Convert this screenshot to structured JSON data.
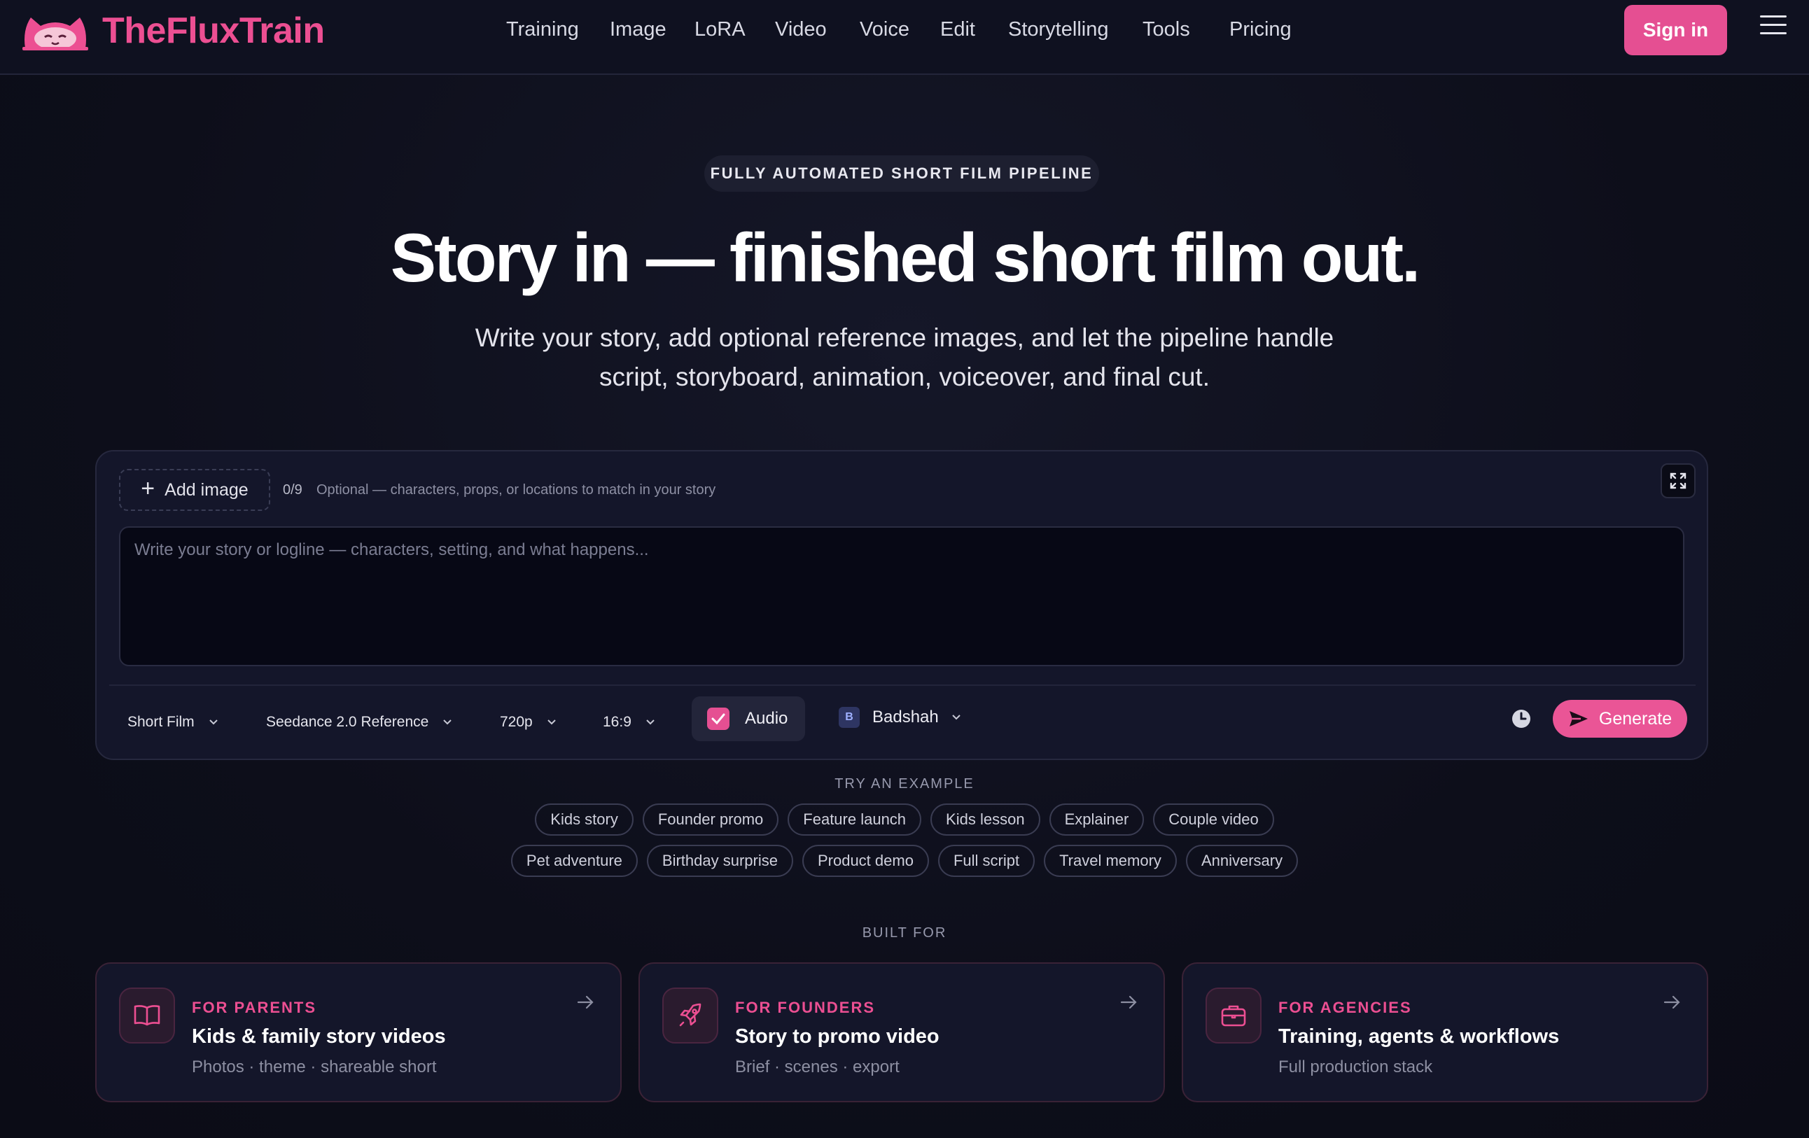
{
  "brand": {
    "name": "TheFluxTrain",
    "accent": "#ec4f92"
  },
  "nav": {
    "items": [
      "Training",
      "Image",
      "LoRA",
      "Video",
      "Voice",
      "Edit",
      "Storytelling",
      "Tools",
      "Pricing"
    ],
    "sign_in": "Sign in",
    "menu_icon": "hamburger-icon"
  },
  "hero": {
    "tag": "FULLY AUTOMATED SHORT FILM PIPELINE",
    "title": "Story in — finished short film out.",
    "subtitle_line1": "Write your story, add optional reference images, and let the pipeline handle",
    "subtitle_line2": "script, storyboard, animation, voiceover, and final cut."
  },
  "composer": {
    "add_image": "Add image",
    "image_count": "0/9",
    "image_hint": "Optional — characters, props, or locations to match in your story",
    "story_placeholder": "Write your story or logline — characters, setting, and what happens...",
    "story_value": "",
    "format": "Short Film",
    "model": "Seedance 2.0 Reference",
    "resolution": "720p",
    "aspect": "16:9",
    "audio_label": "Audio",
    "audio_checked": true,
    "voice_initial": "B",
    "voice_name": "Badshah",
    "generate": "Generate"
  },
  "examples": {
    "label": "TRY AN EXAMPLE",
    "row1": [
      "Kids story",
      "Founder promo",
      "Feature launch",
      "Kids lesson",
      "Explainer",
      "Couple video"
    ],
    "row2": [
      "Pet adventure",
      "Birthday surprise",
      "Product demo",
      "Full script",
      "Travel memory",
      "Anniversary"
    ]
  },
  "built_for": {
    "label": "BUILT FOR",
    "cards": [
      {
        "kicker": "FOR PARENTS",
        "title": "Kids & family story videos",
        "subtitle": "Photos · theme · shareable short",
        "icon": "book-icon"
      },
      {
        "kicker": "FOR FOUNDERS",
        "title": "Story to promo video",
        "subtitle": "Brief · scenes · export",
        "icon": "rocket-icon"
      },
      {
        "kicker": "FOR AGENCIES",
        "title": "Training, agents & workflows",
        "subtitle": "Full production stack",
        "icon": "briefcase-icon"
      }
    ]
  }
}
